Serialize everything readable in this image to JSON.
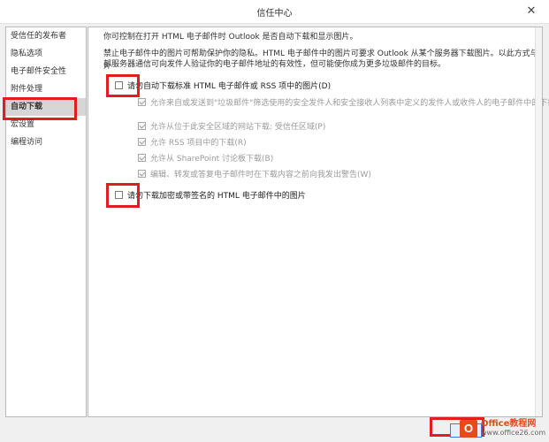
{
  "window": {
    "title": "信任中心",
    "close": "✕"
  },
  "sidebar": {
    "items": [
      {
        "label": "受信任的发布者"
      },
      {
        "label": "隐私选项"
      },
      {
        "label": "电子邮件安全性"
      },
      {
        "label": "附件处理"
      },
      {
        "label": "自动下载"
      },
      {
        "label": "宏设置"
      },
      {
        "label": "编程访问"
      }
    ],
    "selected": "自动下载"
  },
  "main": {
    "intro": "你可控制在打开 HTML 电子邮件时 Outlook 是否自动下载和显示图片。",
    "para1": "禁止电子邮件中的图片可帮助保护你的隐私。HTML 电子邮件中的图片可要求 Outlook 从某个服务器下载图片。以此方式与外",
    "para2": "部服务器通信可向发件人验证你的电子邮件地址的有效性，但可能使你成为更多垃圾邮件的目标。",
    "option_main": {
      "label": "请勿自动下载标准 HTML 电子邮件或 RSS 项中的图片(D)",
      "checked": false
    },
    "sub_options": [
      {
        "label": "允许来自或发送到\"垃圾邮件\"筛选使用的安全发件人和安全接收人列表中定义的发件人或收件人的电子邮件中的下载",
        "checked": true
      },
      {
        "label": "允许从位于此安全区域的网站下载: 受信任区域(P)",
        "checked": true
      },
      {
        "label": "允许 RSS 项目中的下载(R)",
        "checked": true
      },
      {
        "label": "允许从 SharePoint 讨论板下载(B)",
        "checked": true
      },
      {
        "label": "编辑、转发或答复电子邮件时在下载内容之前向我发出警告(W)",
        "checked": true
      }
    ],
    "option_encrypted": {
      "label": "请勿下载加密或带签名的 HTML 电子邮件中的图片",
      "checked": false
    }
  },
  "watermark": {
    "logo_letter": "O",
    "title": "Office教程网",
    "url": "www.office26.com"
  },
  "colors": {
    "highlight": "#e11d1d",
    "accent": "#3b7dd8",
    "brand": "#e74a1b"
  }
}
